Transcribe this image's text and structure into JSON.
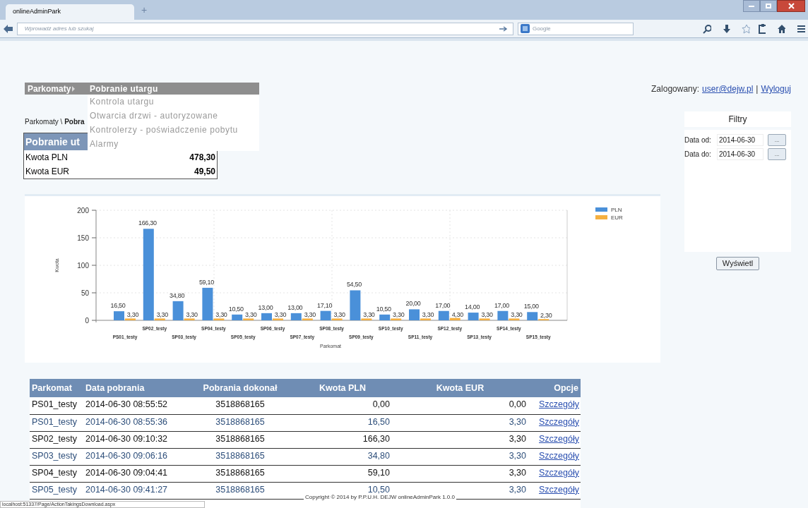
{
  "browser": {
    "tab": {
      "title": "onlineAdminPark"
    },
    "new_tab": "+",
    "address_bar": {
      "placeholder": "Wprowadź adres lub szukaj"
    },
    "search_box": {
      "placeholder": "Google"
    }
  },
  "menu": {
    "root": "Parkomaty",
    "submenu": [
      {
        "label": "Pobranie utargu",
        "selected": true
      },
      {
        "label": "Kontrola utargu",
        "selected": false
      },
      {
        "label": "Otwarcia drzwi - autoryzowane",
        "selected": false
      },
      {
        "label": "Kontrolerzy - poświadczenie pobytu",
        "selected": false
      },
      {
        "label": "Alarmy",
        "selected": false
      }
    ]
  },
  "user": {
    "label": "Zalogowany:",
    "email": "user@dejw.pl",
    "separator": "|",
    "logout": "Wyloguj"
  },
  "breadcrumb": "Parkomaty \\ **Pobra**",
  "summary": {
    "title": "Pobranie ut",
    "rows": [
      {
        "label": "Kwota PLN",
        "value": "478,30"
      },
      {
        "label": "Kwota EUR",
        "value": "49,50"
      }
    ]
  },
  "chart": {
    "chart_data": {
      "type": "bar",
      "xlabel": "Parkomat",
      "ylabel": "Kwota",
      "categories": [
        "PS01_testy",
        "SP02_testy",
        "SP03_testy",
        "SP04_testy",
        "SP05_testy",
        "SP06_testy",
        "SP07_testy",
        "SP08_testy",
        "SP09_testy",
        "SP10_testy",
        "SP11_testy",
        "SP12_testy",
        "SP13_testy",
        "SP14_testy",
        "SP15_testy"
      ],
      "series": [
        {
          "name": "PLN",
          "color": "#4a90d9",
          "values": [
            16.5,
            166.3,
            34.8,
            59.1,
            10.5,
            13,
            13,
            17.1,
            54.5,
            10.5,
            20,
            17,
            14,
            17,
            15
          ],
          "value_labels": [
            "16,50",
            "166,30",
            "34,80",
            "59,10",
            "10,50",
            "13,00",
            "13,00",
            "17,10",
            "54,50",
            "10,50",
            "20,00",
            "17,00",
            "14,00",
            "17,00",
            "15,00"
          ]
        },
        {
          "name": "EUR",
          "color": "#f5b041",
          "values": [
            3.3,
            3.3,
            3.3,
            3.3,
            3.3,
            3.3,
            3.3,
            3.3,
            3.3,
            3.3,
            3.3,
            4.3,
            3.3,
            3.3,
            2.3
          ],
          "value_labels": [
            "3,30",
            "3,30",
            "3,30",
            "3,30",
            "3,30",
            "3,30",
            "3,30",
            "3,30",
            "3,30",
            "3,30",
            "3,30",
            "4,30",
            "3,30",
            "3,30",
            "2,30"
          ]
        }
      ],
      "ylim": [
        0,
        200
      ],
      "yticks": [
        0,
        50,
        100,
        150,
        200
      ],
      "data_labels": true,
      "grid": true,
      "legend": "right"
    }
  },
  "filters": {
    "title": "Filtry",
    "fields": [
      {
        "label": "Data od:",
        "value": "2014-06-30",
        "button": "..."
      },
      {
        "label": "Data do:",
        "value": "2014-06-30",
        "button": "..."
      }
    ],
    "submit": "Wyświetl"
  },
  "table": {
    "columns": [
      "Parkomat",
      "Data pobrania",
      "Pobrania dokonał",
      "Kwota PLN",
      "Kwota EUR",
      "Opcje"
    ],
    "rows": [
      {
        "parkomat": "PS01_testy",
        "date": "2014-06-30 08:55:52",
        "by": "3518868165",
        "pln": "0,00",
        "eur": "0,00",
        "action": "Szczegóły"
      },
      {
        "parkomat": "PS01_testy",
        "date": "2014-06-30 08:55:36",
        "by": "3518868165",
        "pln": "16,50",
        "eur": "3,30",
        "action": "Szczegóły"
      },
      {
        "parkomat": "SP02_testy",
        "date": "2014-06-30 09:10:32",
        "by": "3518868165",
        "pln": "166,30",
        "eur": "3,30",
        "action": "Szczegóły"
      },
      {
        "parkomat": "SP03_testy",
        "date": "2014-06-30 09:06:16",
        "by": "3518868165",
        "pln": "34,80",
        "eur": "3,30",
        "action": "Szczegóły"
      },
      {
        "parkomat": "SP04_testy",
        "date": "2014-06-30 09:04:41",
        "by": "3518868165",
        "pln": "59,10",
        "eur": "3,30",
        "action": "Szczegóły"
      },
      {
        "parkomat": "SP05_testy",
        "date": "2014-06-30 09:41:27",
        "by": "3518868165",
        "pln": "10,50",
        "eur": "3,30",
        "action": "Szczegóły"
      }
    ]
  },
  "footer": "Copyright © 2014 by P.P.U.H. DEJW onlineAdminPark 1.0.0",
  "status_bar": "localhost:51337/Page/ActionTakingsDownload.aspx"
}
